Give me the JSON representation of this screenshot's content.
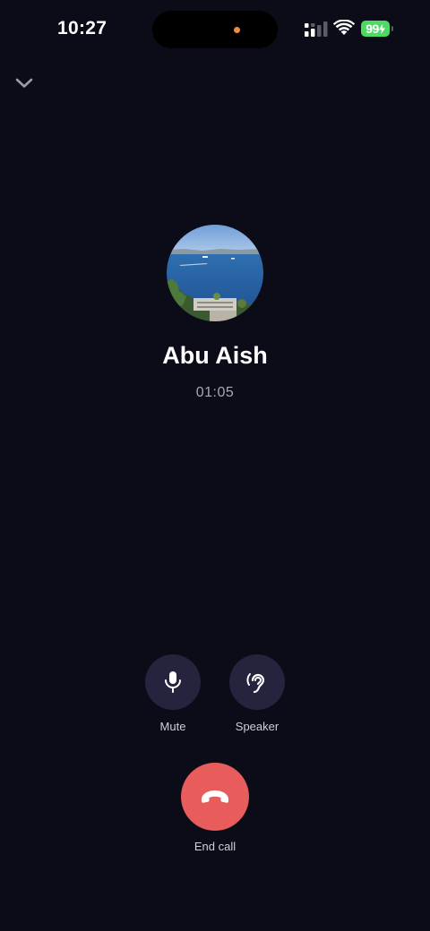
{
  "status_bar": {
    "time": "10:27",
    "battery": "99",
    "icons": [
      "signal-icon",
      "wifi-icon",
      "battery-icon"
    ]
  },
  "call": {
    "caller_name": "Abu Aish",
    "duration": "01:05"
  },
  "controls": {
    "mute_label": "Mute",
    "speaker_label": "Speaker",
    "end_call_label": "End call"
  },
  "colors": {
    "background": "#0c0b18",
    "control_bg": "#25233d",
    "end_call": "#e85c5c",
    "battery": "#4cd964",
    "indicator_dot": "#f28c3b"
  }
}
